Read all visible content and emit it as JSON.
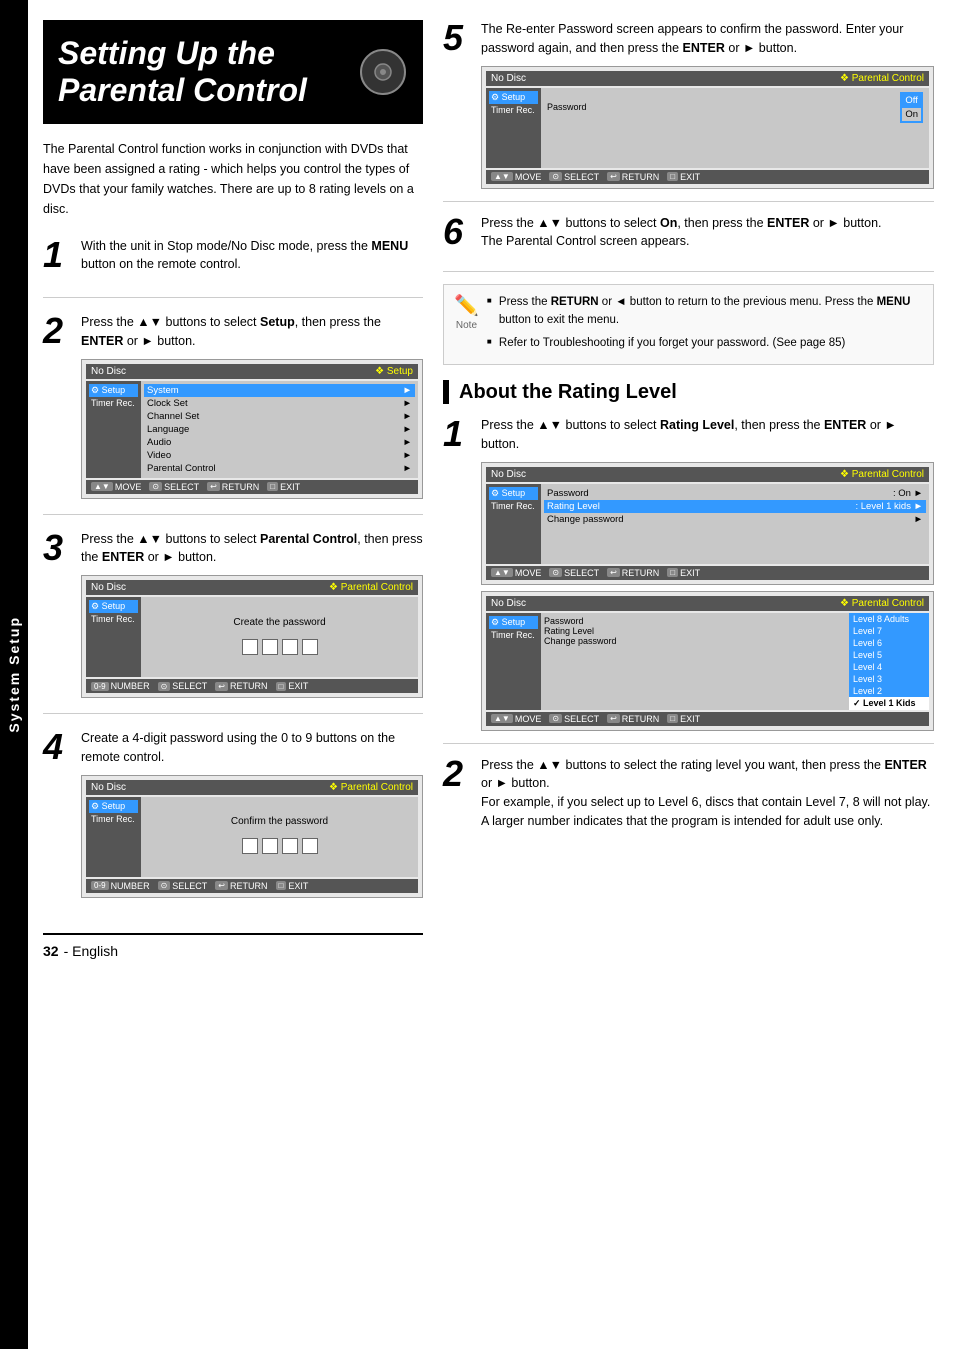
{
  "page": {
    "title": "Setting Up the Parental Control",
    "side_tab": "System Setup",
    "page_number": "32",
    "page_language": "- English"
  },
  "description": "The Parental Control function works in conjunction with DVDs that have been assigned a rating - which helps you control the types of DVDs that your family watches. There are up to 8 rating levels on a disc.",
  "left_steps": [
    {
      "number": "1",
      "text": "With the unit in Stop mode/No Disc mode, press the MENU button on the remote control."
    },
    {
      "number": "2",
      "text": "Press the ▲▼ buttons to select Setup, then press the ENTER or ► button.",
      "screen": {
        "header_left": "No Disc",
        "header_right": "❖ Setup",
        "sidebar": [
          "⚙ Setup",
          "Timer Rec."
        ],
        "menu_items": [
          "System",
          "Clock Set",
          "Channel Set",
          "Language",
          "Audio",
          "Video",
          "Parental Control"
        ],
        "highlighted": "System",
        "footer": [
          "MOVE",
          "SELECT",
          "RETURN",
          "EXIT"
        ]
      }
    },
    {
      "number": "3",
      "text": "Press the ▲▼ buttons to select Parental Control, then press the ENTER or ► button.",
      "screen": {
        "header_left": "No Disc",
        "header_right": "❖ Parental Control",
        "sidebar": [
          "⚙ Setup",
          "Timer Rec."
        ],
        "center_text": "Create the password",
        "password_boxes": 4,
        "footer": [
          "NUMBER",
          "SELECT",
          "RETURN",
          "EXIT"
        ]
      }
    },
    {
      "number": "4",
      "text": "Create a 4-digit password using the 0 to 9 buttons on the remote control.",
      "screen": {
        "header_left": "No Disc",
        "header_right": "❖ Parental Control",
        "sidebar": [
          "⚙ Setup",
          "Timer Rec."
        ],
        "center_text": "Confirm the password",
        "password_boxes": 4,
        "footer": [
          "NUMBER",
          "SELECT",
          "RETURN",
          "EXIT"
        ]
      }
    }
  ],
  "right_steps_top": [
    {
      "number": "5",
      "text": "The Re-enter Password screen appears to confirm the password. Enter your password again, and then press the ENTER or ► button.",
      "screen": {
        "header_left": "No Disc",
        "header_right": "❖ Parental Control",
        "sidebar": [
          "⚙ Setup",
          "Timer Rec."
        ],
        "menu_label": "Password",
        "options": [
          "Off",
          "On"
        ],
        "selected": "Off",
        "footer": [
          "MOVE",
          "SELECT",
          "RETURN",
          "EXIT"
        ]
      }
    },
    {
      "number": "6",
      "text": "Press the ▲▼ buttons to select On, then press the ENTER or ► button.",
      "subtext": "The Parental Control screen appears."
    }
  ],
  "note": {
    "items": [
      "Press the RETURN or ◄ button to return to the previous menu. Press the MENU button to exit the menu.",
      "Refer to Troubleshooting if you forget your password. (See page 85)"
    ]
  },
  "rating_section": {
    "heading": "About the Rating Level",
    "steps": [
      {
        "number": "1",
        "text": "Press the ▲▼ buttons to select Rating Level, then press the ENTER or ► button.",
        "screen1": {
          "header_left": "No Disc",
          "header_right": "❖ Parental Control",
          "sidebar": [
            "⚙ Setup",
            "Timer Rec."
          ],
          "rows": [
            {
              "label": "Password",
              "value": ": On",
              "arrow": true
            },
            {
              "label": "Rating Level",
              "value": ": Level 1 kids",
              "arrow": true,
              "highlighted": true
            },
            {
              "label": "Change password",
              "value": "",
              "arrow": true
            }
          ],
          "footer": [
            "MOVE",
            "SELECT",
            "RETURN",
            "EXIT"
          ]
        },
        "screen2": {
          "header_left": "No Disc",
          "header_right": "❖ Parental Control",
          "sidebar": [
            "⚙ Setup",
            "Timer Rec."
          ],
          "rows": [
            {
              "label": "Password",
              "value": "Level 8 Adults"
            },
            {
              "label": "Rating Level",
              "value": "Level 7"
            },
            {
              "label": "Change password",
              "value": "Level 6"
            }
          ],
          "dropdown": [
            "Level 8 Adults",
            "Level 7",
            "Level 6",
            "Level 5",
            "Level 4",
            "Level 3",
            "Level 2",
            "✓ Level 1 Kids"
          ],
          "selected_dropdown": "✓ Level 1 Kids",
          "footer": [
            "MOVE",
            "SELECT",
            "RETURN",
            "EXIT"
          ]
        }
      },
      {
        "number": "2",
        "text": "Press the ▲▼ buttons to select the rating level you want, then press the ENTER or ► button.",
        "subtext": "For example, if you select up to Level 6, discs that contain Level 7, 8 will not play. A larger number indicates that the program is intended for adult use only."
      }
    ]
  }
}
